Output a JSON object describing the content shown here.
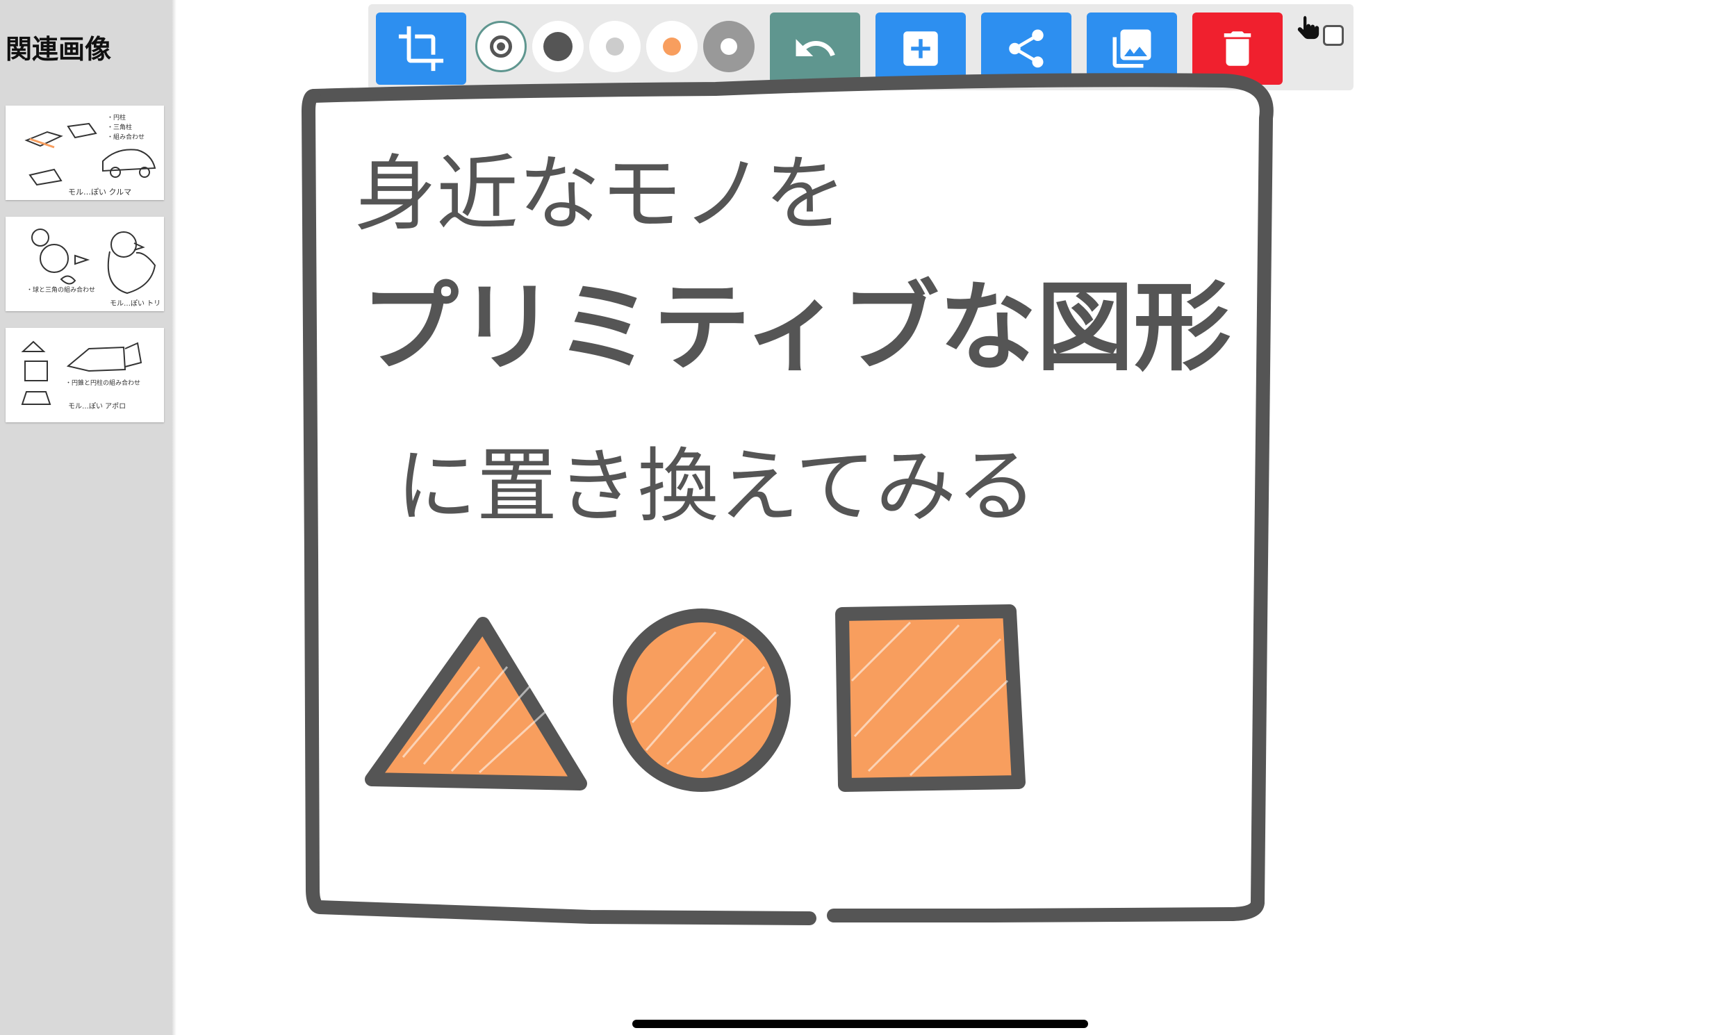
{
  "sidebar": {
    "title": "関連画像",
    "thumbnails": [
      {
        "caption": "モル…ぽい クルマ"
      },
      {
        "caption": "モル…ぽい トリ"
      },
      {
        "caption": "モル…ぽい アポロ"
      }
    ]
  },
  "toolbar": {
    "buttons": [
      {
        "name": "crop",
        "icon": "crop-icon",
        "color": "#2d8ff0"
      },
      {
        "name": "undo",
        "icon": "undo-icon",
        "color": "#5f968f"
      },
      {
        "name": "add",
        "icon": "add-box-icon",
        "color": "#2d8ff0"
      },
      {
        "name": "share",
        "icon": "share-icon",
        "color": "#2d8ff0"
      },
      {
        "name": "gallery",
        "icon": "photo-library-icon",
        "color": "#2d8ff0"
      },
      {
        "name": "delete",
        "icon": "trash-icon",
        "color": "#f0202e"
      }
    ],
    "pen_options": [
      {
        "name": "pen-size-selected",
        "dot_color": "#555555",
        "selected": true
      },
      {
        "name": "pen-size-large",
        "dot_color": "#555555",
        "selected": false
      },
      {
        "name": "pen-color-light-gray",
        "dot_color": "#cccccc",
        "selected": false
      },
      {
        "name": "pen-color-orange",
        "dot_color": "#f89e5e",
        "selected": false
      },
      {
        "name": "pen-eraser",
        "dot_color": "#ffffff",
        "selected": false
      }
    ],
    "touch_icon": "hand-pointer-icon"
  },
  "canvas": {
    "line1": "身近なモノを",
    "line2": "プリミティブな図形",
    "line3": "に置き換えてみる",
    "stroke_color": "#555555",
    "fill_color": "#f89e5e"
  }
}
